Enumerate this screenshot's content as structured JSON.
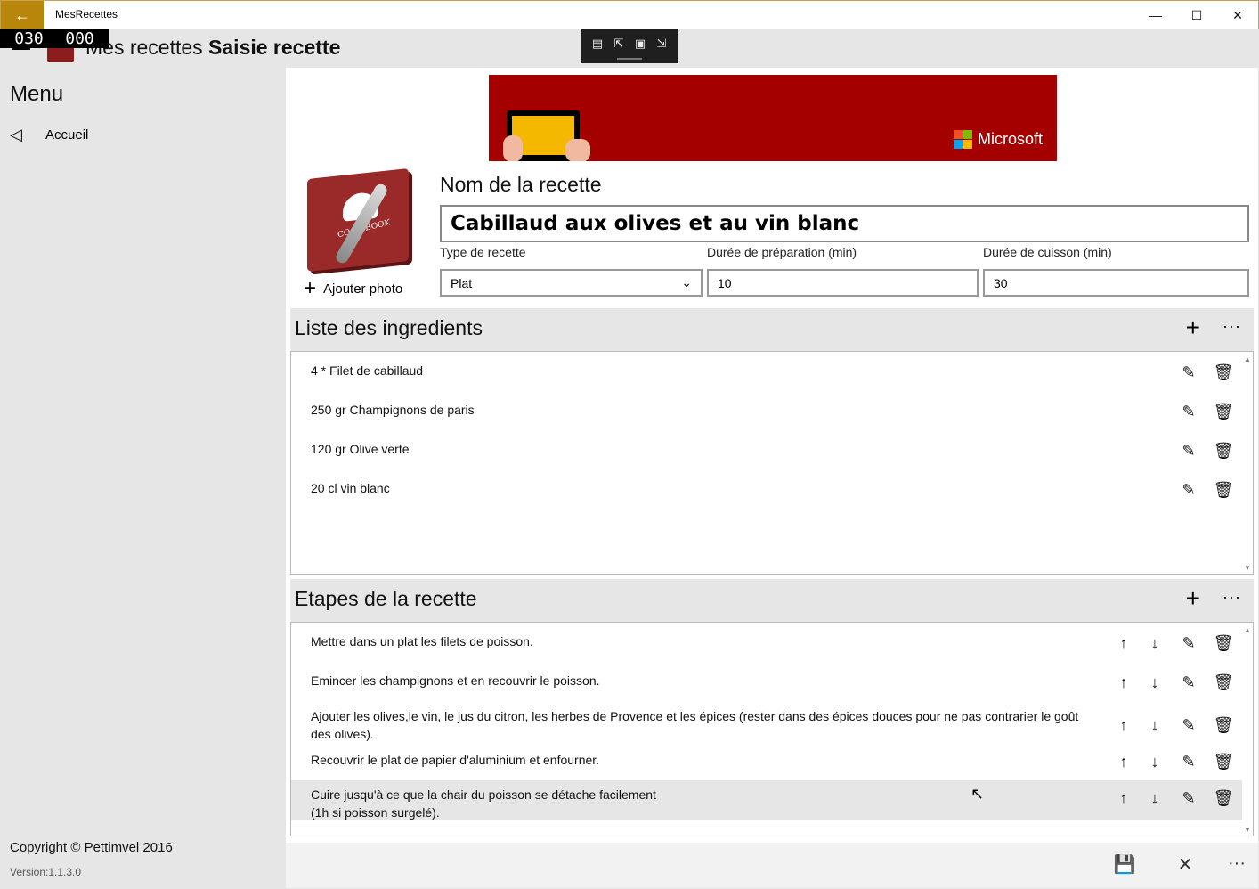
{
  "window": {
    "title": "MesRecettes",
    "back_glyph": "←",
    "minimize_glyph": "—",
    "maximize_glyph": "☐",
    "close_glyph": "✕"
  },
  "frame_counter": {
    "left": "030",
    "right": "000"
  },
  "debug_toolbar": {
    "icons": [
      "▤",
      "⇱",
      "▣",
      "⇲"
    ]
  },
  "header": {
    "app": "Mes recettes",
    "page": "Saisie recette"
  },
  "sidebar": {
    "menu_title": "Menu",
    "home_icon": "◁",
    "home_label": "Accueil",
    "copyright": "Copyright © Pettimvel 2016",
    "version": "Version:1.1.3.0"
  },
  "ad": {
    "brand": "Microsoft"
  },
  "photo": {
    "book_label": "COOK BOOK",
    "add_glyph": "+",
    "add_label": "Ajouter photo"
  },
  "form": {
    "name_label": "Nom de la recette",
    "name_value": "Cabillaud aux olives et au vin blanc",
    "type_label": "Type de recette",
    "type_value": "Plat",
    "prep_label": "Durée de préparation (min)",
    "prep_value": "10",
    "cook_label": "Durée de cuisson (min)",
    "cook_value": "30"
  },
  "ingredients": {
    "title": "Liste des ingredients",
    "items": [
      "4 * Filet de cabillaud",
      "250 gr Champignons de paris",
      "120 gr Olive verte",
      "20 cl vin blanc"
    ]
  },
  "steps": {
    "title": "Etapes de la recette",
    "items": [
      "Mettre dans un plat les filets de poisson.",
      "Emincer les champignons et en recouvrir le poisson.",
      "Ajouter les olives,le vin, le jus du citron, les herbes de Provence et les épices (rester dans des épices douces pour ne pas contrarier le goût des olives).",
      "Recouvrir le plat de papier d'aluminium et enfourner.",
      "Cuire jusqu'à ce que la chair du poisson se détache facilement\n(1h si poisson surgelé)."
    ]
  },
  "glyphs": {
    "add": "+",
    "more": "···",
    "edit": "✎",
    "delete": "🗑",
    "up": "↑",
    "down": "↓",
    "dropdown": "⌄",
    "save": "💾",
    "cancel": "✕",
    "cursor": "↖",
    "scroll_up": "▲",
    "scroll_down": "▼"
  },
  "colors": {
    "titlebar_accent": "#b8860b",
    "ad_background": "#a50000"
  }
}
